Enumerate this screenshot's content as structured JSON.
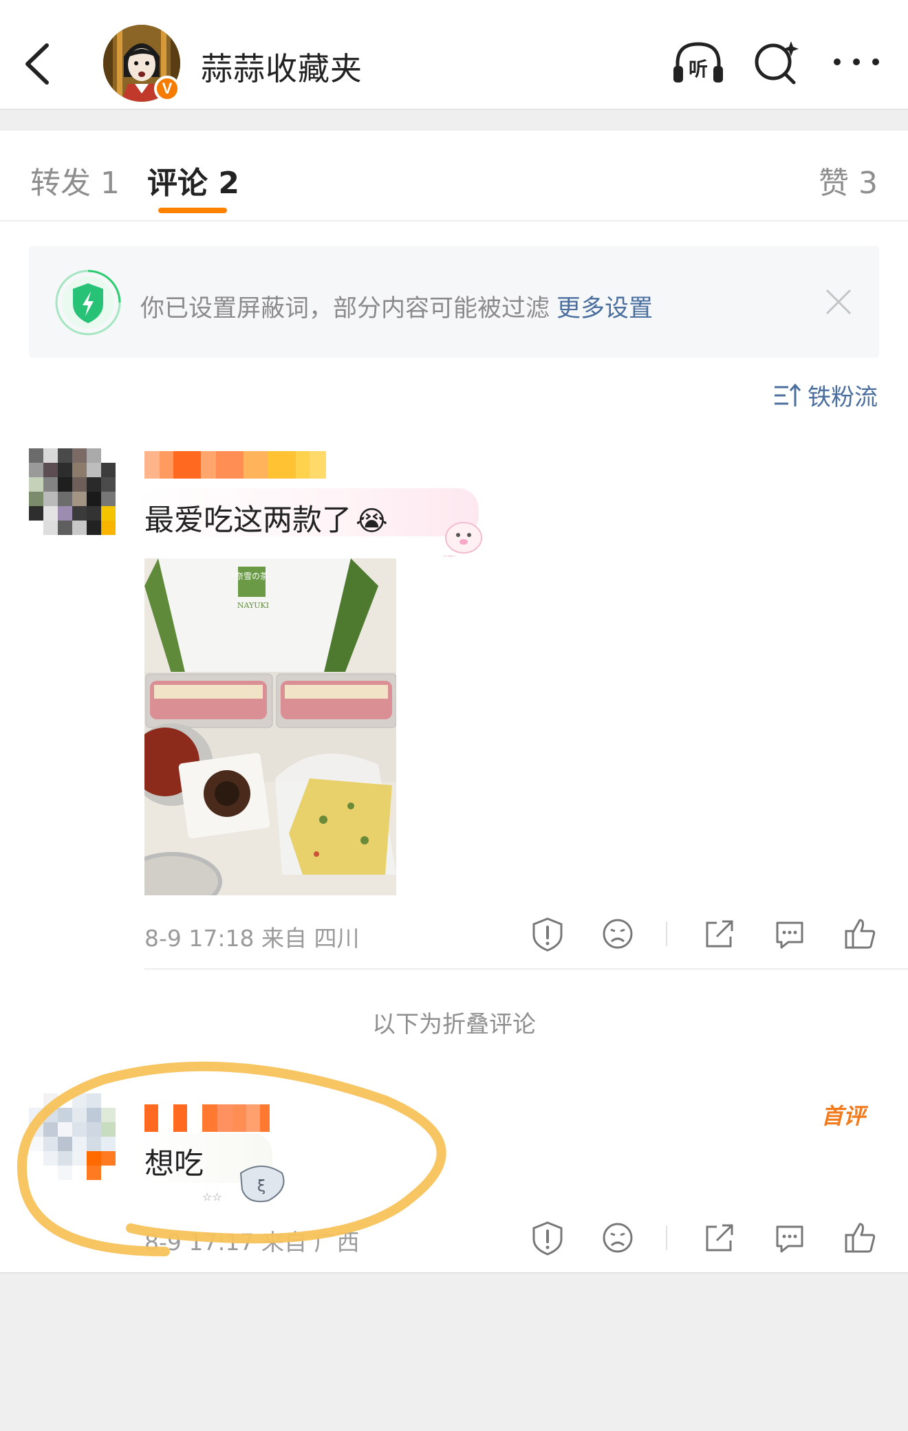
{
  "header": {
    "title": "蒜蒜收藏夹",
    "verified_badge": "V",
    "icons": [
      "back-arrow-icon",
      "listen-headphones-icon",
      "search-icon",
      "more-icon"
    ],
    "listen_label": "听"
  },
  "tabs": [
    {
      "label": "转发 1",
      "active": false
    },
    {
      "label": "评论 2",
      "active": true
    },
    {
      "label": "赞 3",
      "active": false
    }
  ],
  "notice": {
    "text": "你已设置屏蔽词，部分内容可能被过滤",
    "link": "更多设置"
  },
  "sort": {
    "label": "铁粉流"
  },
  "comments": [
    {
      "text": "最爱吃这两款了",
      "emoji": "😭",
      "meta": "8-9 17:18 来自 四川",
      "photo_brand": "奈雪の茶",
      "photo_brand_en": "NAYUKI"
    },
    {
      "text": "想吃",
      "meta": "8-9 17:17 来自 广西",
      "badge": "首评"
    }
  ],
  "fold_text": "以下为折叠评论",
  "colors": {
    "accent": "#ff8200",
    "link": "#4a6f9e",
    "annotation": "#f7c25a"
  }
}
